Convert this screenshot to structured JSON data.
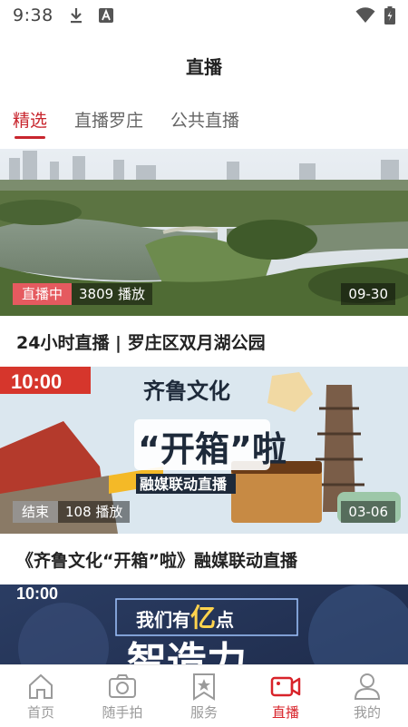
{
  "status_bar": {
    "time": "9:38"
  },
  "header": {
    "title": "直播"
  },
  "tabs": [
    {
      "label": "精选",
      "active": true
    },
    {
      "label": "直播罗庄",
      "active": false
    },
    {
      "label": "公共直播",
      "active": false
    }
  ],
  "feed": [
    {
      "title": "24小时直播 | 罗庄区双月湖公园",
      "state": "直播中",
      "plays": "3809 播放",
      "date": "09-30"
    },
    {
      "title": "《齐鲁文化“开箱”啦》融媒联动直播",
      "state": "结束",
      "plays": "108 播放",
      "date": "03-06",
      "poster": {
        "time": "10:00",
        "headline1": "齐鲁文化",
        "headline2": "“开箱”啦",
        "subtitle": "融媒联动直播"
      }
    },
    {
      "poster": {
        "time": "10:00",
        "headline1": "我们有",
        "headline_mark": "亿",
        "headline_suffix": "点",
        "headline2": "智造力"
      }
    }
  ],
  "bottom_nav": [
    {
      "label": "首页",
      "icon": "home-icon",
      "active": false
    },
    {
      "label": "随手拍",
      "icon": "camera-icon",
      "active": false
    },
    {
      "label": "服务",
      "icon": "bookmark-star-icon",
      "active": false
    },
    {
      "label": "直播",
      "icon": "video-camera-icon",
      "active": true
    },
    {
      "label": "我的",
      "icon": "person-icon",
      "active": false
    }
  ],
  "colors": {
    "accent": "#d8232a",
    "live_badge": "#e55a5f",
    "inactive": "#9a9a9a"
  }
}
